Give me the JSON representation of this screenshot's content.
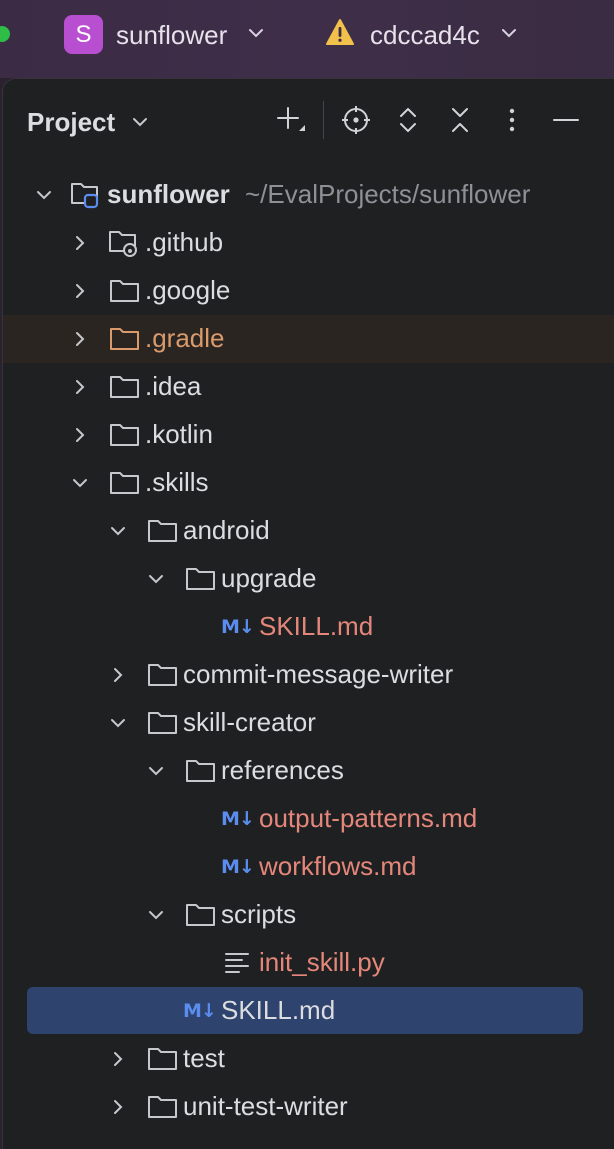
{
  "titlebar": {
    "project_badge": "S",
    "project_name": "sunflower",
    "branch": "cdccad4c",
    "colors": {
      "badge": "#b74fd0",
      "warning": "#f2c14b",
      "traffic_green": "#2ebd47"
    }
  },
  "panel": {
    "title": "Project",
    "toolbar": [
      "add-icon",
      "locate-icon",
      "expand-all-icon",
      "collapse-all-icon",
      "more-icon",
      "hide-icon"
    ]
  },
  "tree": [
    {
      "label": "sunflower",
      "path": "~/EvalProjects/sunflower",
      "kind": "module-root",
      "expanded": true,
      "depth": 0
    },
    {
      "label": ".github",
      "kind": "folder-github",
      "expanded": false,
      "depth": 1
    },
    {
      "label": ".google",
      "kind": "folder",
      "expanded": false,
      "depth": 1
    },
    {
      "label": ".gradle",
      "kind": "folder-excluded",
      "expanded": false,
      "depth": 1
    },
    {
      "label": ".idea",
      "kind": "folder",
      "expanded": false,
      "depth": 1
    },
    {
      "label": ".kotlin",
      "kind": "folder",
      "expanded": false,
      "depth": 1
    },
    {
      "label": ".skills",
      "kind": "folder",
      "expanded": true,
      "depth": 1
    },
    {
      "label": "android",
      "kind": "folder",
      "expanded": true,
      "depth": 2
    },
    {
      "label": "upgrade",
      "kind": "folder",
      "expanded": true,
      "depth": 3
    },
    {
      "label": "SKILL.md",
      "kind": "markdown",
      "status": "changed",
      "depth": 4
    },
    {
      "label": "commit-message-writer",
      "kind": "folder",
      "expanded": false,
      "depth": 2
    },
    {
      "label": "skill-creator",
      "kind": "folder",
      "expanded": true,
      "depth": 2
    },
    {
      "label": "references",
      "kind": "folder",
      "expanded": true,
      "depth": 3
    },
    {
      "label": "output-patterns.md",
      "kind": "markdown",
      "status": "changed",
      "depth": 4
    },
    {
      "label": "workflows.md",
      "kind": "markdown",
      "status": "changed",
      "depth": 4
    },
    {
      "label": "scripts",
      "kind": "folder",
      "expanded": true,
      "depth": 3
    },
    {
      "label": "init_skill.py",
      "kind": "text-file",
      "status": "changed",
      "depth": 4
    },
    {
      "label": "SKILL.md",
      "kind": "markdown",
      "status": "selected",
      "depth": 3
    },
    {
      "label": "test",
      "kind": "folder",
      "expanded": false,
      "depth": 2
    },
    {
      "label": "unit-test-writer",
      "kind": "folder",
      "expanded": false,
      "depth": 2
    }
  ],
  "md_icon_text": "M↓",
  "colors": {
    "panel_bg": "#1f2022",
    "selection": "#2e436e",
    "changed_text": "#e4877a",
    "excluded_text": "#d99a6c",
    "markdown_icon": "#5b8def"
  }
}
